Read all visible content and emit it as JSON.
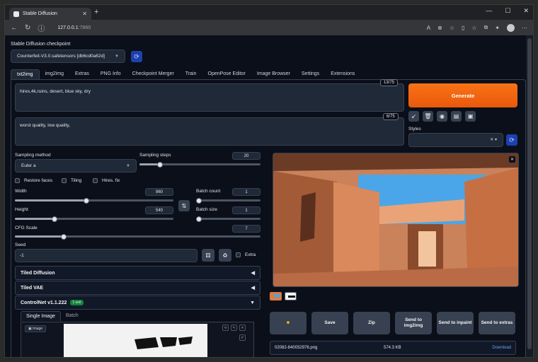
{
  "browser": {
    "tab_title": "Stable Diffusion",
    "tab_close": "✕",
    "new_tab": "+",
    "url_host": "127.0.0.1",
    "url_port": ":7860",
    "window_controls": [
      "—",
      "☐",
      "✕"
    ]
  },
  "checkpoint": {
    "label": "Stable Diffusion checkpoint",
    "value": "Counterfeit-V3.0.safetensors [db6cd0a62d]"
  },
  "tabs": [
    "txt2img",
    "img2img",
    "Extras",
    "PNG Info",
    "Checkpoint Merger",
    "Train",
    "OpenPose Editor",
    "Image Browser",
    "Settings",
    "Extensions"
  ],
  "active_tab": "txt2img",
  "prompt": {
    "positive": "hires,4k,ruins, desert, blue sky, dry",
    "positive_count": "13/75",
    "negative": "worst quality, low quality,",
    "negative_count": "6/75"
  },
  "generate_label": "Generate",
  "styles_label": "Styles",
  "sampling": {
    "method_label": "Sampling method",
    "method_value": "Euler a",
    "steps_label": "Sampling steps",
    "steps_value": "20",
    "steps_fraction": 0.17
  },
  "checkboxes": {
    "restore_faces": "Restore faces",
    "tiling": "Tiling",
    "hires_fix": "Hires. fix"
  },
  "width": {
    "label": "Width",
    "value": "960",
    "fraction": 0.45
  },
  "height": {
    "label": "Height",
    "value": "540",
    "fraction": 0.25
  },
  "batch_count": {
    "label": "Batch count",
    "value": "1",
    "fraction": 0.0
  },
  "batch_size": {
    "label": "Batch size",
    "value": "1",
    "fraction": 0.0
  },
  "cfg": {
    "label": "CFG Scale",
    "value": "7",
    "fraction": 0.2
  },
  "seed": {
    "label": "Seed",
    "value": "-1",
    "extra_label": "Extra"
  },
  "accordions": {
    "tiled_diffusion": "Tiled Diffusion",
    "tiled_vae": "Tiled VAE",
    "controlnet": "ControlNet v1.1.222",
    "controlnet_badge": "1 unit"
  },
  "controlnet_tabs": [
    "Single Image",
    "Batch"
  ],
  "image_tag": "Image",
  "actions": {
    "folder_icon": "folder-icon",
    "save": "Save",
    "zip": "Zip",
    "send_img2img": "Send to img2img",
    "send_inpaint": "Send to inpaint",
    "send_extras": "Send to extras"
  },
  "file": {
    "name": "02082-840032976.png",
    "size": "574.3 KB",
    "download": "Download"
  },
  "colors": {
    "accent": "#f97316",
    "background": "#0b0f19",
    "panel": "#1f2937"
  }
}
